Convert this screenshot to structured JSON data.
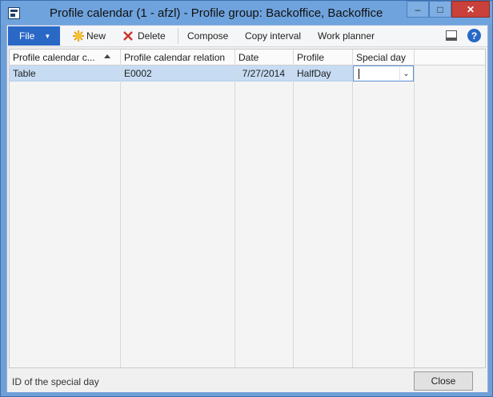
{
  "window": {
    "title": "Profile calendar (1 - afzl) - Profile group: Backoffice, Backoffice",
    "controls": {
      "minimize": "–",
      "maximize": "□",
      "close": "✕"
    }
  },
  "toolbar": {
    "file_label": "File",
    "new_label": "New",
    "delete_label": "Delete",
    "compose_label": "Compose",
    "copy_interval_label": "Copy interval",
    "work_planner_label": "Work planner",
    "help_glyph": "?",
    "icons": [
      "app-icon",
      "new-icon",
      "delete-icon",
      "panel-toggle-icon",
      "help-icon"
    ]
  },
  "grid": {
    "columns": [
      "Profile calendar c...",
      "Profile calendar relation",
      "Date",
      "Profile",
      "Special day"
    ],
    "rows": [
      {
        "profile_calendar": "Table",
        "relation": "E0002",
        "date": "7/27/2014",
        "profile": "HalfDay",
        "special_day": ""
      }
    ]
  },
  "status": {
    "help_text": "ID of the special day",
    "close_label": "Close"
  },
  "colors": {
    "title_bar": "#6fa3dd",
    "file_button": "#2a68c6",
    "selected_row": "#c7dcf3",
    "close_window": "#c9413a"
  }
}
